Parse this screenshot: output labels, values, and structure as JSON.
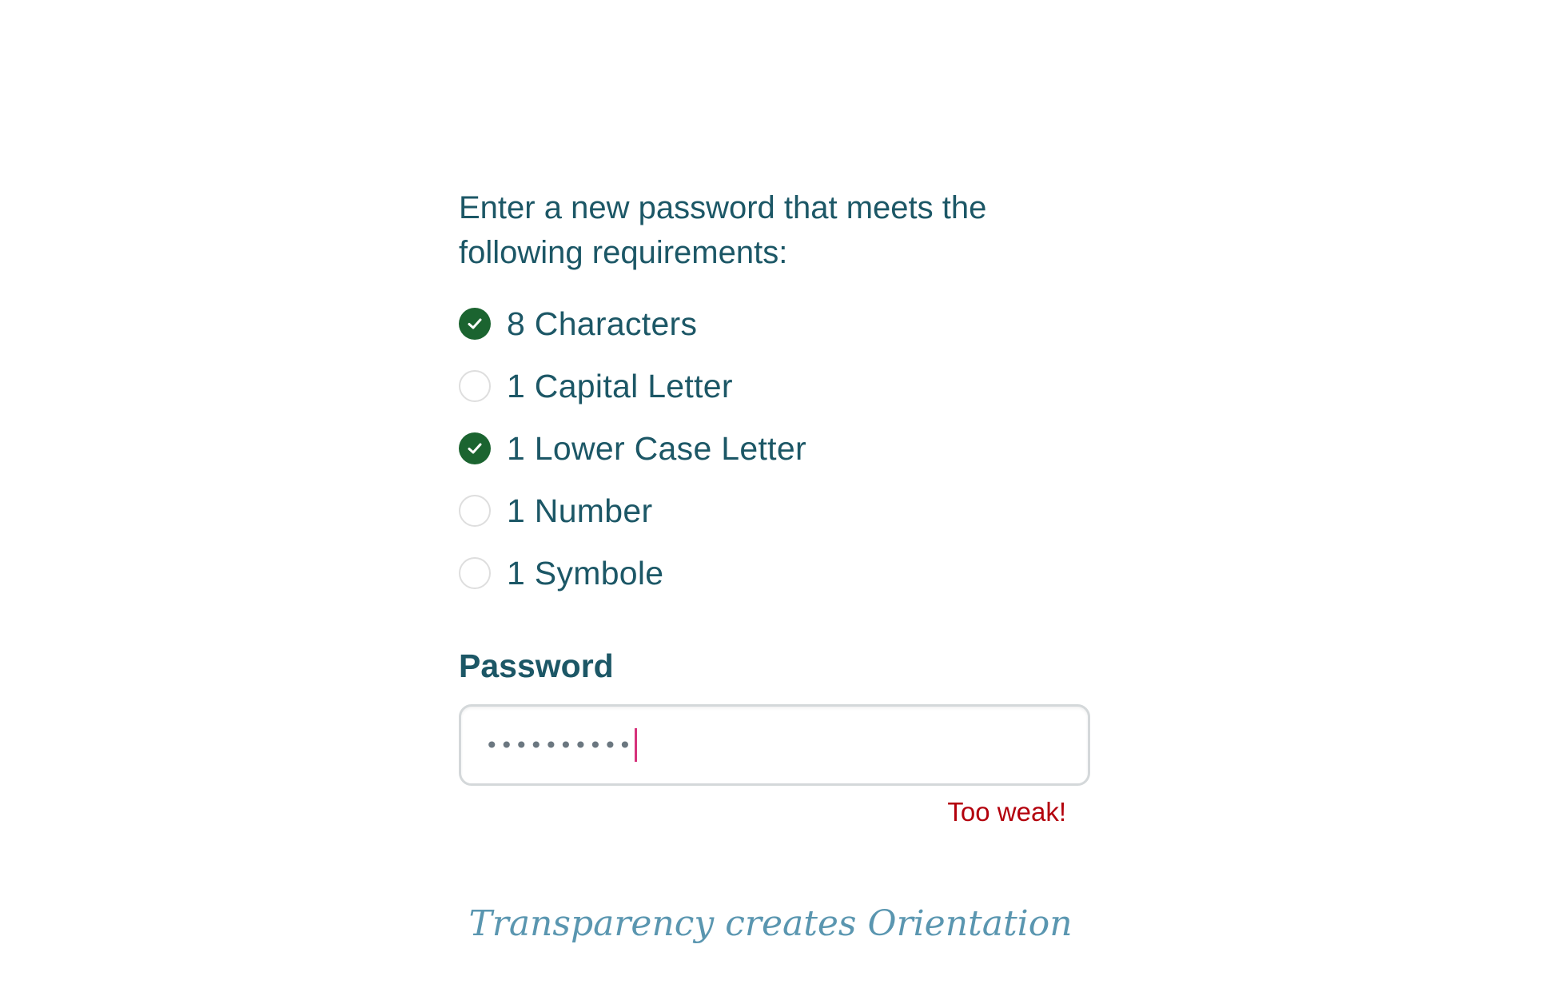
{
  "form": {
    "intro": "Enter a new password that meets the following requirements:",
    "requirements": [
      {
        "label": "8 Characters",
        "met": true,
        "icon": "check-circle-icon"
      },
      {
        "label": "1 Capital Letter",
        "met": false,
        "icon": "empty-circle-icon"
      },
      {
        "label": "1 Lower Case Letter",
        "met": true,
        "icon": "check-circle-icon"
      },
      {
        "label": "1 Number",
        "met": false,
        "icon": "empty-circle-icon"
      },
      {
        "label": "1 Symbole",
        "met": false,
        "icon": "empty-circle-icon"
      }
    ],
    "password_label": "Password",
    "password_value": "••••••••••",
    "strength_text": "Too weak!"
  },
  "tagline": "Transparency creates Orientation",
  "colors": {
    "text": "#1c5766",
    "check": "#1b6430",
    "error": "#b3000c",
    "caret": "#d6317a",
    "tagline": "#5a96b0"
  }
}
